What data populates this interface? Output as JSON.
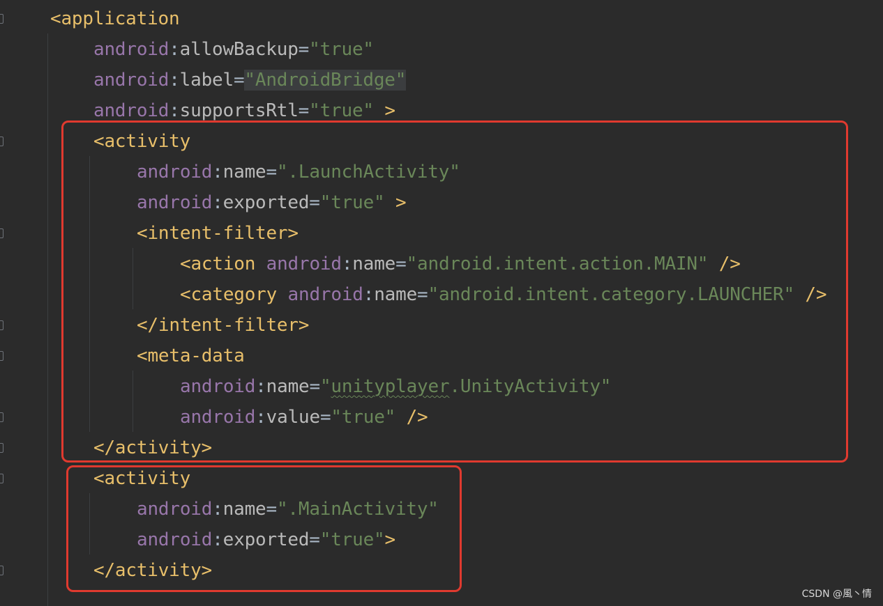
{
  "editor": {
    "lines": [
      {
        "id": "l1",
        "parts": [
          {
            "t": "tag",
            "v": "<application"
          }
        ]
      },
      {
        "id": "l2",
        "parts": [
          {
            "t": "ns",
            "v": "android"
          },
          {
            "t": "eq",
            "v": ":"
          },
          {
            "t": "attr",
            "v": "allowBackup"
          },
          {
            "t": "eq",
            "v": "="
          },
          {
            "t": "val",
            "v": "\"true\""
          }
        ]
      },
      {
        "id": "l3",
        "parts": [
          {
            "t": "ns",
            "v": "android"
          },
          {
            "t": "eq",
            "v": ":"
          },
          {
            "t": "attr",
            "v": "label"
          },
          {
            "t": "eq",
            "v": "="
          },
          {
            "t": "hlval",
            "v": "\"AndroidBridge\""
          }
        ]
      },
      {
        "id": "l4",
        "parts": [
          {
            "t": "ns",
            "v": "android"
          },
          {
            "t": "eq",
            "v": ":"
          },
          {
            "t": "attr",
            "v": "supportsRtl"
          },
          {
            "t": "eq",
            "v": "="
          },
          {
            "t": "val",
            "v": "\"true\""
          },
          {
            "t": "tag",
            "v": " >"
          }
        ]
      },
      {
        "id": "l5",
        "parts": [
          {
            "t": "tag",
            "v": "<activity"
          }
        ]
      },
      {
        "id": "l6",
        "parts": [
          {
            "t": "ns",
            "v": "android"
          },
          {
            "t": "eq",
            "v": ":"
          },
          {
            "t": "attr",
            "v": "name"
          },
          {
            "t": "eq",
            "v": "="
          },
          {
            "t": "val",
            "v": "\".LaunchActivity\""
          }
        ]
      },
      {
        "id": "l7",
        "parts": [
          {
            "t": "ns",
            "v": "android"
          },
          {
            "t": "eq",
            "v": ":"
          },
          {
            "t": "attr",
            "v": "exported"
          },
          {
            "t": "eq",
            "v": "="
          },
          {
            "t": "val",
            "v": "\"true\""
          },
          {
            "t": "tag",
            "v": " >"
          }
        ]
      },
      {
        "id": "l8",
        "parts": [
          {
            "t": "tag",
            "v": "<intent-filter>"
          }
        ]
      },
      {
        "id": "l9",
        "parts": [
          {
            "t": "tag",
            "v": "<action "
          },
          {
            "t": "ns",
            "v": "android"
          },
          {
            "t": "eq",
            "v": ":"
          },
          {
            "t": "attr",
            "v": "name"
          },
          {
            "t": "eq",
            "v": "="
          },
          {
            "t": "val",
            "v": "\"android.intent.action.MAIN\""
          },
          {
            "t": "tag",
            "v": " />"
          }
        ]
      },
      {
        "id": "l10",
        "parts": [
          {
            "t": "tag",
            "v": "<category "
          },
          {
            "t": "ns",
            "v": "android"
          },
          {
            "t": "eq",
            "v": ":"
          },
          {
            "t": "attr",
            "v": "name"
          },
          {
            "t": "eq",
            "v": "="
          },
          {
            "t": "val",
            "v": "\"android.intent.category.LAUNCHER\""
          },
          {
            "t": "tag",
            "v": " />"
          }
        ]
      },
      {
        "id": "l11",
        "parts": [
          {
            "t": "tag",
            "v": "</intent-filter>"
          }
        ]
      },
      {
        "id": "l12",
        "parts": [
          {
            "t": "tag",
            "v": "<meta-data"
          }
        ]
      },
      {
        "id": "l13",
        "parts": [
          {
            "t": "ns",
            "v": "android"
          },
          {
            "t": "eq",
            "v": ":"
          },
          {
            "t": "attr",
            "v": "name"
          },
          {
            "t": "eq",
            "v": "="
          },
          {
            "t": "val",
            "v": "\""
          },
          {
            "t": "sqval",
            "v": "unityplayer"
          },
          {
            "t": "val",
            "v": ".UnityActivity\""
          }
        ]
      },
      {
        "id": "l14",
        "parts": [
          {
            "t": "ns",
            "v": "android"
          },
          {
            "t": "eq",
            "v": ":"
          },
          {
            "t": "attr",
            "v": "value"
          },
          {
            "t": "eq",
            "v": "="
          },
          {
            "t": "val",
            "v": "\"true\""
          },
          {
            "t": "tag",
            "v": " />"
          }
        ]
      },
      {
        "id": "l15",
        "parts": [
          {
            "t": "tag",
            "v": "</activity>"
          }
        ]
      },
      {
        "id": "l16",
        "parts": [
          {
            "t": "tag",
            "v": "<activity"
          }
        ]
      },
      {
        "id": "l17",
        "parts": [
          {
            "t": "ns",
            "v": "android"
          },
          {
            "t": "eq",
            "v": ":"
          },
          {
            "t": "attr",
            "v": "name"
          },
          {
            "t": "eq",
            "v": "="
          },
          {
            "t": "val",
            "v": "\".MainActivity\""
          }
        ]
      },
      {
        "id": "l18",
        "parts": [
          {
            "t": "ns",
            "v": "android"
          },
          {
            "t": "eq",
            "v": ":"
          },
          {
            "t": "attr",
            "v": "exported"
          },
          {
            "t": "eq",
            "v": "="
          },
          {
            "t": "val",
            "v": "\"true\""
          },
          {
            "t": "tag",
            "v": ">"
          }
        ]
      },
      {
        "id": "l19",
        "parts": [
          {
            "t": "tag",
            "v": "</activity>"
          }
        ]
      }
    ]
  },
  "colors": {
    "background": "#2b2b2b",
    "tag": "#e8bf6a",
    "namespace": "#9876aa",
    "attribute": "#bababa",
    "value": "#6a8759",
    "annotation_box": "#e03a2f"
  },
  "watermark": "CSDN @風丶情"
}
